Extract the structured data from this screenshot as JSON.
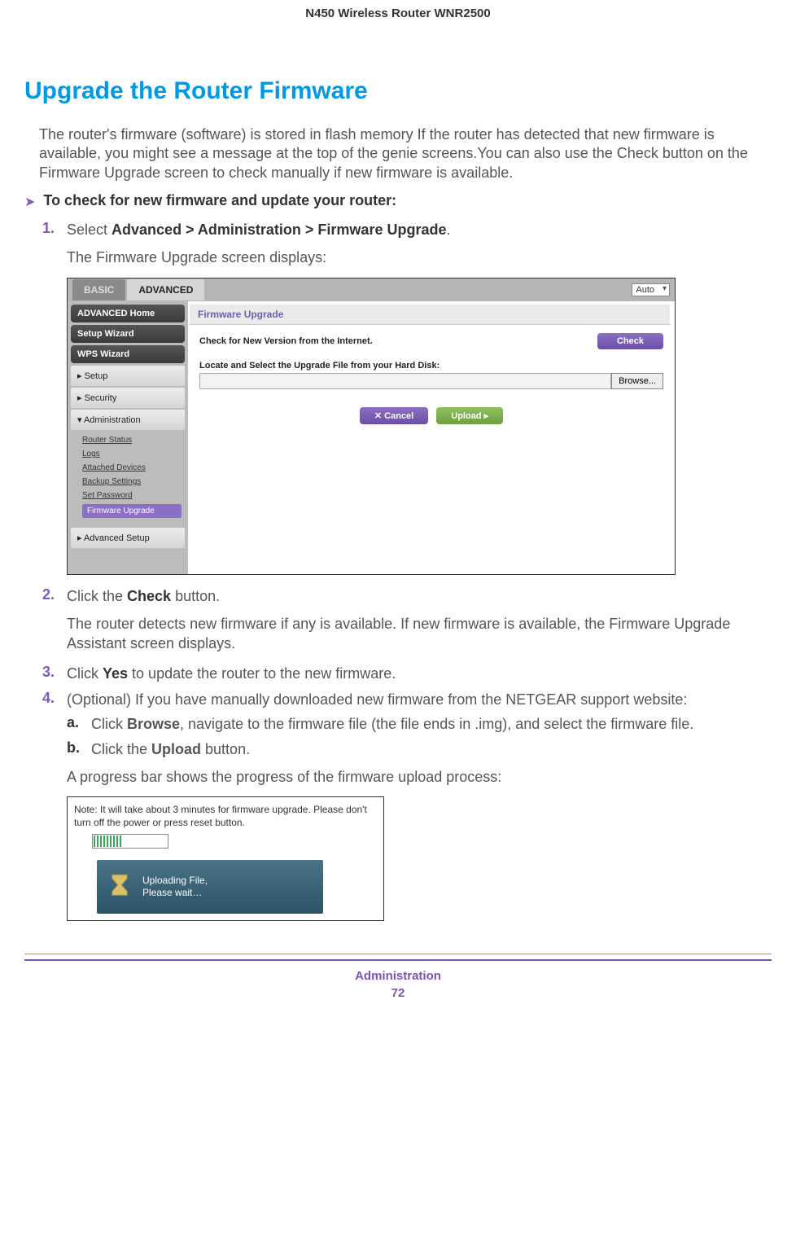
{
  "doc_header": "N450 Wireless Router WNR2500",
  "heading": "Upgrade the Router Firmware",
  "intro": "The router's firmware (software) is stored in flash memory If the router has detected that new firmware is available, you might see a message at the top of the genie screens.You can also use the Check button on the Firmware Upgrade screen to check manually if new firmware is available.",
  "task_title": "To check for new firmware and update your router:",
  "step1_num": "1.",
  "step1_pre": "Select ",
  "step1_bold": "Advanced > Administration > Firmware Upgrade",
  "step1_post": ".",
  "step1_follow": "The Firmware Upgrade screen displays:",
  "step2_num": "2.",
  "step2_pre": "Click the ",
  "step2_bold": "Check",
  "step2_post": " button.",
  "step2_follow": "The router detects new firmware if any is available. If new firmware is available, the Firmware Upgrade Assistant screen displays.",
  "step3_num": "3.",
  "step3_pre": "Click ",
  "step3_bold": "Yes",
  "step3_post": " to update the router to the new firmware.",
  "step4_num": "4.",
  "step4_text": "(Optional) If you have manually downloaded new firmware from the NETGEAR support website:",
  "substep_a_num": "a.",
  "substep_a_pre": "Click ",
  "substep_a_bold": "Browse",
  "substep_a_post": ", navigate to the firmware file (the file ends in .img), and select the firmware file.",
  "substep_b_num": "b.",
  "substep_b_pre": "Click the ",
  "substep_b_bold": "Upload",
  "substep_b_post": " button.",
  "progress_intro": "A progress bar shows the progress of the firmware upload process:",
  "screenshot": {
    "tab_basic": "BASIC",
    "tab_advanced": "ADVANCED",
    "auto_dropdown": "Auto",
    "sidebar": {
      "home": "ADVANCED Home",
      "setup_wizard": "Setup Wizard",
      "wps_wizard": "WPS Wizard",
      "setup": "▸ Setup",
      "security": "▸ Security",
      "administration": "▾ Administration",
      "subitems": {
        "router_status": "Router Status",
        "logs": "Logs",
        "attached": "Attached Devices",
        "backup": "Backup Settings",
        "set_password": "Set Password",
        "firmware_upgrade": "Firmware Upgrade"
      },
      "advanced_setup": "▸ Advanced Setup"
    },
    "panel": {
      "title": "Firmware Upgrade",
      "check_label": "Check for New Version from the Internet.",
      "check_btn": "Check",
      "locate_label": "Locate and Select the Upgrade File from your Hard Disk:",
      "browse_btn": "Browse...",
      "cancel_btn": "✕   Cancel",
      "upload_btn": "Upload   ▸"
    }
  },
  "progress_shot": {
    "note": "Note: It will take about 3 minutes for firmware upgrade. Please don't turn off the power or press reset button.",
    "uploading_line1": "Uploading File,",
    "uploading_line2": "Please wait…"
  },
  "footer_label": "Administration",
  "footer_page": "72"
}
